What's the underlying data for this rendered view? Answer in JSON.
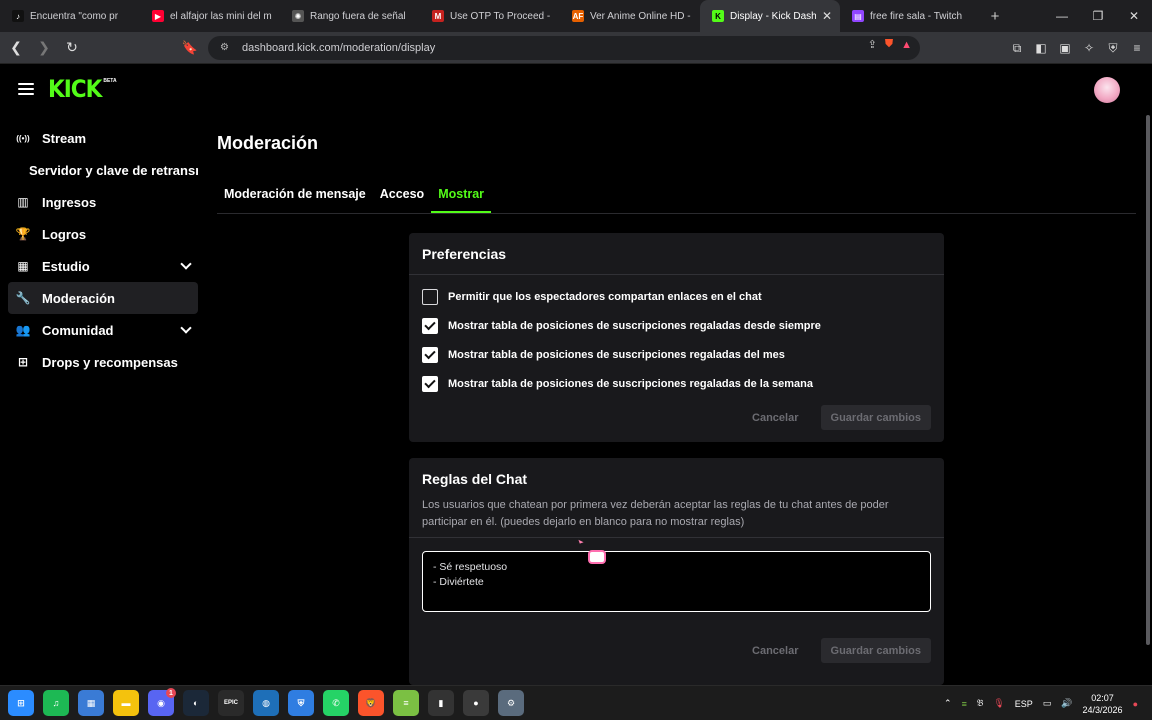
{
  "browser": {
    "tabs": [
      {
        "label": "Encuentra \"como pr",
        "favicon": "tiktok-icon",
        "color": "#111111",
        "glyph": "♪"
      },
      {
        "label": "el alfajor las mini del m",
        "favicon": "youtube-icon",
        "color": "#ff0033",
        "glyph": "▶"
      },
      {
        "label": "Rango fuera de señal",
        "favicon": "chatgpt-icon",
        "color": "#555555",
        "glyph": "✺"
      },
      {
        "label": "Use OTP To Proceed - b",
        "favicon": "gmail-icon",
        "color": "#c5221f",
        "glyph": "M"
      },
      {
        "label": "Ver Anime Online HD -",
        "favicon": "animeflv-icon",
        "color": "#e66000",
        "glyph": "AF"
      },
      {
        "label": "Display - Kick Dash",
        "favicon": "kick-icon",
        "color": "#53fc18",
        "glyph": "K",
        "active": true
      },
      {
        "label": "free fire sala - Twitch",
        "favicon": "twitch-icon",
        "color": "#9146ff",
        "glyph": "▤"
      }
    ],
    "new_tab": "+",
    "url": "dashboard.kick.com/moderation/display"
  },
  "brand": {
    "logo": "KICK",
    "beta": "BETA",
    "accent": "#53fc18"
  },
  "sidebar": {
    "items": [
      {
        "label": "Stream",
        "icon": "broadcast-icon",
        "glyph": "((•))"
      },
      {
        "label": "Servidor y clave de retransmisión",
        "sub": true
      },
      {
        "label": "Ingresos",
        "icon": "chart-icon",
        "glyph": "▥"
      },
      {
        "label": "Logros",
        "icon": "trophy-icon",
        "glyph": "🏆"
      },
      {
        "label": "Estudio",
        "icon": "film-icon",
        "glyph": "▦",
        "expandable": true
      },
      {
        "label": "Moderación",
        "icon": "wrench-icon",
        "glyph": "🔧",
        "active": true
      },
      {
        "label": "Comunidad",
        "icon": "community-icon",
        "glyph": "👥",
        "expandable": true
      },
      {
        "label": "Drops y recompensas",
        "icon": "drops-icon",
        "glyph": "⊞"
      }
    ]
  },
  "main": {
    "title": "Moderación",
    "tabs": [
      {
        "label": "Moderación de mensaje"
      },
      {
        "label": "Acceso"
      },
      {
        "label": "Mostrar",
        "active": true
      }
    ]
  },
  "preferences": {
    "heading": "Preferencias",
    "options": [
      {
        "label": "Permitir que los espectadores compartan enlaces en el chat",
        "checked": false
      },
      {
        "label": "Mostrar tabla de posiciones de suscripciones regaladas desde siempre",
        "checked": true
      },
      {
        "label": "Mostrar tabla de posiciones de suscripciones regaladas del mes",
        "checked": true
      },
      {
        "label": "Mostrar tabla de posiciones de suscripciones regaladas de la semana",
        "checked": true
      }
    ],
    "cancel": "Cancelar",
    "save": "Guardar cambios"
  },
  "chat_rules": {
    "heading": "Reglas del Chat",
    "description": "Los usuarios que chatean por primera vez deberán aceptar las reglas de tu chat antes de poder participar en él. (puedes dejarlo en blanco para no mostrar reglas)",
    "value": "- Sé respetuoso\n- Diviértete",
    "cancel": "Cancelar",
    "save": "Guardar cambios"
  },
  "taskbar": {
    "apps": [
      {
        "name": "windows-start-icon",
        "glyph": "⊞",
        "color": "#2b8cff"
      },
      {
        "name": "spotify-icon",
        "glyph": "♫",
        "color": "#1db954"
      },
      {
        "name": "microsoft-store-icon",
        "glyph": "▦",
        "color": "#3a7bd5"
      },
      {
        "name": "file-explorer-icon",
        "glyph": "▬",
        "color": "#f4c20d"
      },
      {
        "name": "discord-icon",
        "glyph": "◉",
        "color": "#5865f2",
        "badge": "1"
      },
      {
        "name": "steam-icon",
        "glyph": "◐",
        "color": "#1b2838"
      },
      {
        "name": "epic-games-icon",
        "glyph": "EPIC",
        "color": "#2a2a2a"
      },
      {
        "name": "app-icon",
        "glyph": "◍",
        "color": "#1e6fb8"
      },
      {
        "name": "shield-app-icon",
        "glyph": "⛨",
        "color": "#2f7de1"
      },
      {
        "name": "whatsapp-icon",
        "glyph": "✆",
        "color": "#25d366"
      },
      {
        "name": "brave-icon",
        "glyph": "🦁",
        "color": "#fb542b"
      },
      {
        "name": "bluestacks-icon",
        "glyph": "≡",
        "color": "#7bc043"
      },
      {
        "name": "app2-icon",
        "glyph": "▮",
        "color": "#333333"
      },
      {
        "name": "obs-icon",
        "glyph": "●",
        "color": "#3a3a3a"
      },
      {
        "name": "settings-icon",
        "glyph": "⚙",
        "color": "#5a6b7d"
      }
    ],
    "language": "ESP",
    "time": "02:07",
    "date": "24/3/2026"
  }
}
